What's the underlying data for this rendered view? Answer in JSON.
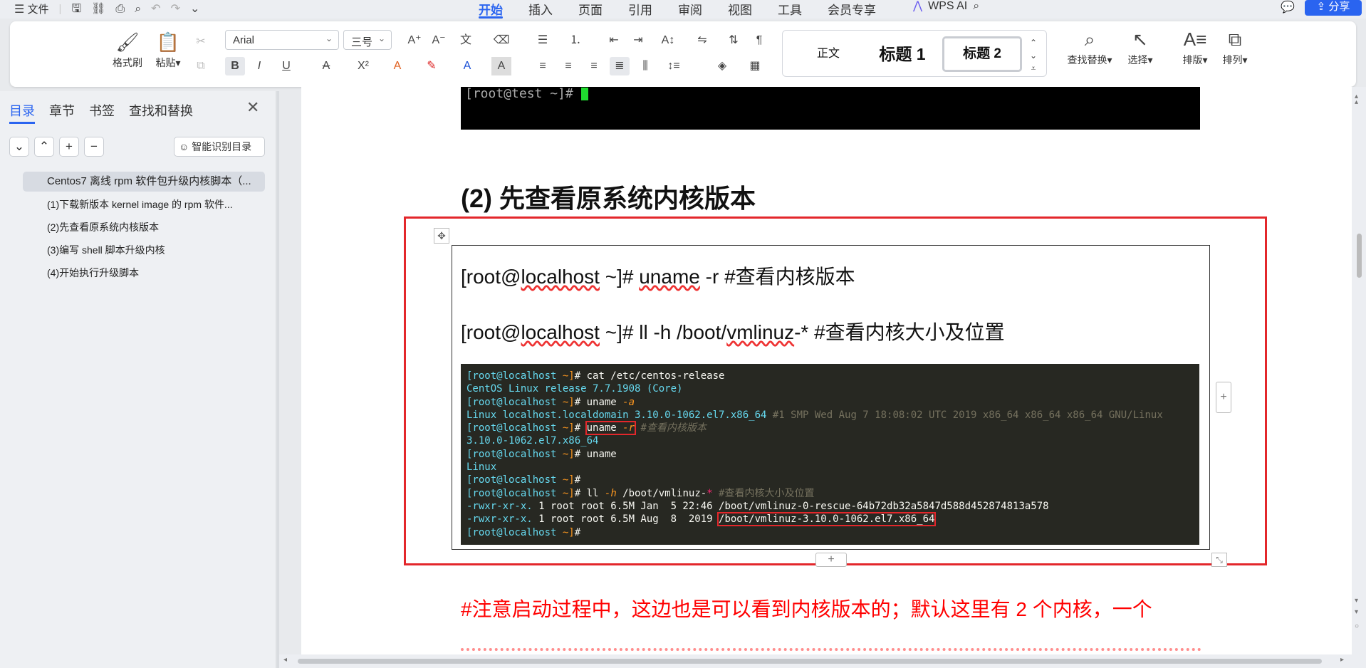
{
  "menubar": {
    "file_label": "文件",
    "tabs": [
      "开始",
      "插入",
      "页面",
      "引用",
      "审阅",
      "视图",
      "工具",
      "会员专享"
    ],
    "wps_ai": "WPS AI",
    "share": "分享"
  },
  "ribbon": {
    "format_brush": "格式刷",
    "paste": "粘贴",
    "font": "Arial",
    "size": "三号",
    "styles": [
      "正文",
      "标题 1",
      "标题 2"
    ],
    "find_replace": "查找替换",
    "select": "选择",
    "layout": "排版",
    "arrange": "排列"
  },
  "sidebar": {
    "tabs": [
      "目录",
      "章节",
      "书签",
      "查找和替换"
    ],
    "ai_toc": "智能识别目录",
    "toc_items": [
      "Centos7 离线 rpm 软件包升级内核脚本（...",
      "(1)下载新版本 kernel image 的 rpm 软件...",
      "(2)先查看原系统内核版本",
      "(3)编写 shell 脚本升级内核",
      "(4)开始执行升级脚本"
    ]
  },
  "doc": {
    "top_term_prompt": "[root@test ~]# ",
    "heading_num": "(2)",
    "heading_text": "先查看原系统内核版本",
    "cmd1_prefix": "[root@",
    "cmd1_host": "localhost",
    "cmd1_mid": " ~]# ",
    "cmd1_cmd": "uname",
    "cmd1_rest": " -r #查看内核版本",
    "cmd2_prefix": "[root@",
    "cmd2_host": "localhost",
    "cmd2_rest": " ~]# ll -h /boot/",
    "cmd2_path": "vmlinuz",
    "cmd2_tail": "-* #查看内核大小及位置",
    "note_line": "#注意启动过程中，这边也是可以看到内核版本的；默认这里有 2 个内核，一个"
  },
  "terminal": {
    "prompt_host": "[root@localhost",
    "prompt_tail": " ~]",
    "lines": {
      "l1_cmd": "# cat /etc/centos-release",
      "l2": "CentOS Linux release 7.7.1908 (Core)",
      "l3_cmd": "# uname ",
      "l3_flag": "-a",
      "l4_a": "Linux localhost.localdomain 3.10.0-1062.el7.x86_64 ",
      "l4_b": "#1 SMP Wed Aug 7 18:08:02 UTC 2019 x86_64 x86_64 x86_64 GNU/Linux",
      "l5_hash": "# ",
      "l5_cmd": "uname ",
      "l5_flag": "-r",
      "l5_comment": " #查看内核版本",
      "l6": "3.10.0-1062.el7.x86_64",
      "l7_cmd": "# uname",
      "l8": "Linux",
      "l9_cmd": "#",
      "l10_cmd": "# ll ",
      "l10_flag": "-h",
      "l10_path": " /boot/vmlinuz-",
      "l10_star": "*",
      "l10_comment": " #查看内核大小及位置",
      "l11_a": "-rwxr-xr-x.",
      "l11_b": " 1 root root 6.5M Jan  5 22:46 ",
      "l11_c": "/boot/vmlinuz-0-rescue-64b72db32a5847d588d452874813a578",
      "l12_a": "-rwxr-xr-x.",
      "l12_b": " 1 root root 6.5M Aug  8  2019 ",
      "l12_c": "/boot/vmlinuz-3.10.0-1062.el7.x86_64",
      "l13_cmd": "#"
    }
  },
  "colors": {
    "accent": "#2a64f0",
    "highlight_red": "#e3272b",
    "note_red": "#ff0000",
    "terminal_bg": "#272822"
  }
}
